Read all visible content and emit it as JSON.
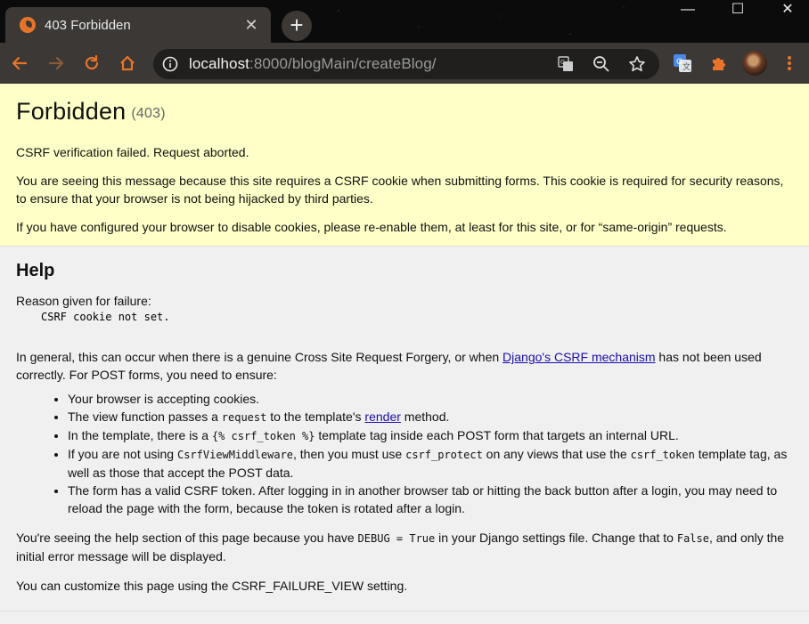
{
  "browser": {
    "tab": {
      "title": "403 Forbidden"
    },
    "new_tab_symbol": "+",
    "window_controls": {
      "minimize": "—",
      "maximize": "☐",
      "close": "✕"
    },
    "address": {
      "host": "localhost",
      "rest": ":8000/blogMain/createBlog/"
    },
    "icons": [
      "back-icon",
      "forward-icon",
      "reload-icon",
      "home-icon",
      "info-icon",
      "translate-icon",
      "zoom-icon",
      "bookmark-star-icon",
      "google-translate-extension-icon",
      "extensions-puzzle-icon",
      "profile-avatar",
      "menu-kebab-icon"
    ]
  },
  "summary": {
    "title": "Forbidden",
    "status_code": "(403)",
    "p1": "CSRF verification failed. Request aborted.",
    "p2": "You are seeing this message because this site requires a CSRF cookie when submitting forms. This cookie is required for security reasons, to ensure that your browser is not being hijacked by third parties.",
    "p3": "If you have configured your browser to disable cookies, please re-enable them, at least for this site, or for “same-origin” requests."
  },
  "help": {
    "title": "Help",
    "reason_label": "Reason given for failure:",
    "reason": "CSRF cookie not set.",
    "general_before": "In general, this can occur when there is a genuine Cross Site Request Forgery, or when ",
    "general_link": "Django's CSRF mechanism",
    "general_after": " has not been used correctly. For POST forms, you need to ensure:",
    "items": {
      "i1": "Your browser is accepting cookies.",
      "i2_before": "The view function passes a ",
      "i2_code": "request",
      "i2_mid": " to the template's ",
      "i2_link": "render",
      "i2_after": " method.",
      "i3_before": "In the template, there is a ",
      "i3_code": "{% csrf_token %}",
      "i3_after": " template tag inside each POST form that targets an internal URL.",
      "i4_before": "If you are not using ",
      "i4_code1": "CsrfViewMiddleware",
      "i4_mid1": ", then you must use ",
      "i4_code2": "csrf_protect",
      "i4_mid2": " on any views that use the ",
      "i4_code3": "csrf_token",
      "i4_after": " template tag, as well as those that accept the POST data.",
      "i5": "The form has a valid CSRF token. After logging in in another browser tab or hitting the back button after a login, you may need to reload the page with the form, because the token is rotated after a login."
    },
    "debug_before": "You're seeing the help section of this page because you have ",
    "debug_code1": "DEBUG = True",
    "debug_mid": " in your Django settings file. Change that to ",
    "debug_code2": "False",
    "debug_after": ", and only the initial error message will be displayed.",
    "custom": "You can customize this page using the CSRF_FAILURE_VIEW setting."
  },
  "colors": {
    "summary_bg": "#ffffc8",
    "toolbar_bg": "#3b3835",
    "link": "#1a0dab",
    "favicon": "#e8742a"
  }
}
